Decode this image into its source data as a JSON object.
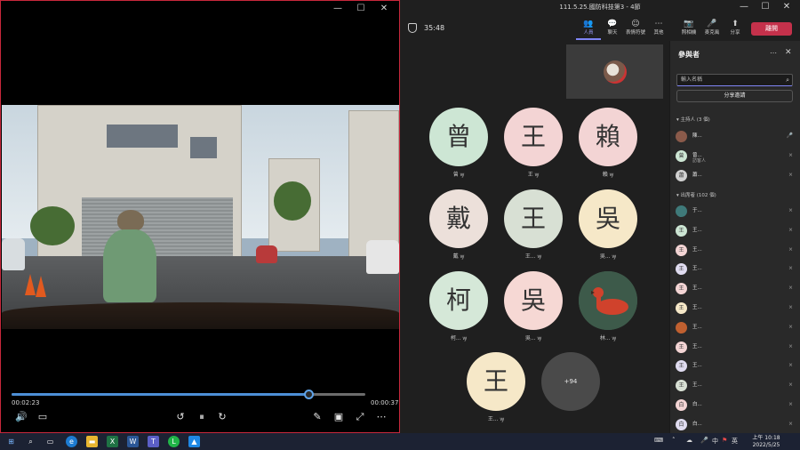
{
  "player": {
    "current_time": "00:02:23",
    "total_time": "00:00:37",
    "progress": 0.838,
    "buttons": {
      "volume": "🔊",
      "subtitles": "▭",
      "rewind": "↺",
      "play_pause": "⏸",
      "forward": "↻",
      "edit": "✎",
      "miniview": "▣",
      "fullscreen": "⤢",
      "more": "⋯"
    }
  },
  "teams": {
    "window_title": "111.5.25.國防科技第3 - 4節",
    "meeting_timer": "35:48",
    "toolbar": [
      {
        "icon": "👥",
        "label": "人員",
        "active": true
      },
      {
        "icon": "💬",
        "label": "聊天",
        "active": false
      },
      {
        "icon": "☺",
        "label": "表情符號",
        "active": false
      },
      {
        "icon": "⋯",
        "label": "其他",
        "active": false
      },
      {
        "icon": "📷",
        "label": "照相機",
        "active": false
      },
      {
        "icon": "🎤",
        "label": "麥克風",
        "active": false
      },
      {
        "icon": "⬆",
        "label": "分享",
        "active": false
      }
    ],
    "leave_label": "離開",
    "tiles": [
      {
        "char": "曾",
        "name": "曾",
        "color": "#cde6d4"
      },
      {
        "char": "王",
        "name": "王",
        "color": "#f3d4d4"
      },
      {
        "char": "賴",
        "name": "賴",
        "color": "#f3d4d4"
      },
      {
        "char": "戴",
        "name": "戴",
        "color": "#ece0da"
      },
      {
        "char": "王",
        "name": "王...",
        "color": "#d8e0d4"
      },
      {
        "char": "吳",
        "name": "吳...",
        "color": "#f6e8c8"
      },
      {
        "char": "柯",
        "name": "柯...",
        "color": "#d5e8d8"
      },
      {
        "char": "吳",
        "name": "吳...",
        "color": "#f6d8d4"
      },
      {
        "char": "",
        "name": "林...",
        "color": "#3d5a4a"
      },
      {
        "char": "王",
        "name": "王...",
        "color": "#f6e8c8"
      }
    ],
    "more_count": "+94",
    "panel": {
      "title": "參與者",
      "search_placeholder": "輸入名稱",
      "share_invite": "分享邀請",
      "organizers_header": "主持人 (3 個)",
      "attendees_header": "出席者 (102 個)",
      "organizers": [
        {
          "avatar": "",
          "name": "陳...",
          "sub": "",
          "color": "#8a5a4a"
        },
        {
          "avatar": "曾",
          "name": "曾...",
          "sub": "訪客人",
          "color": "#cde6d4"
        },
        {
          "avatar": "蕭",
          "name": "蕭...",
          "sub": "",
          "color": "#d0d0d0"
        }
      ],
      "attendees": [
        {
          "avatar": "",
          "name": "于...",
          "color": "#3f7a7a"
        },
        {
          "avatar": "王",
          "name": "王...",
          "color": "#cde6d4"
        },
        {
          "avatar": "王",
          "name": "王...",
          "color": "#f3d4d4"
        },
        {
          "avatar": "王",
          "name": "王...",
          "color": "#e0dcf0"
        },
        {
          "avatar": "王",
          "name": "王...",
          "color": "#f3d4d4"
        },
        {
          "avatar": "王",
          "name": "王...",
          "color": "#f6e8c8"
        },
        {
          "avatar": "",
          "name": "王...",
          "color": "#c06030"
        },
        {
          "avatar": "王",
          "name": "王...",
          "color": "#f3d4d4"
        },
        {
          "avatar": "王",
          "name": "王...",
          "color": "#e0dcf0"
        },
        {
          "avatar": "王",
          "name": "王...",
          "color": "#d8e0d4"
        },
        {
          "avatar": "白",
          "name": "白...",
          "color": "#f3d4d4"
        },
        {
          "avatar": "白",
          "name": "白...",
          "color": "#e0dcf0"
        }
      ]
    }
  },
  "taskbar": {
    "time": "上午 10:18",
    "date": "2022/5/25",
    "ime": "中",
    "lang": "英"
  }
}
